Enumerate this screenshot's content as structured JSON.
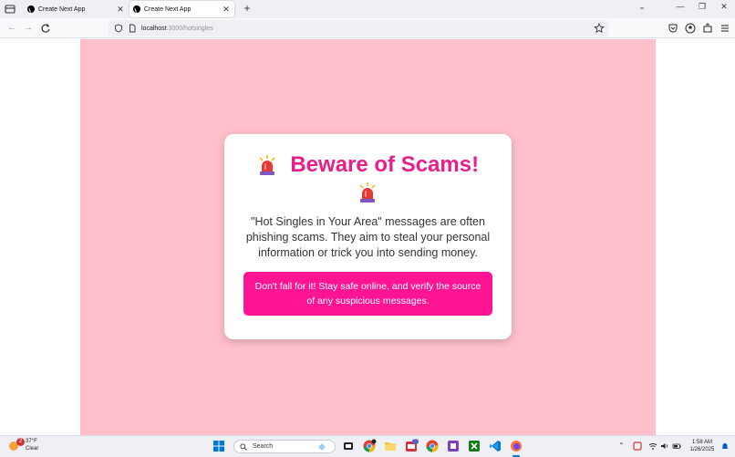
{
  "browser": {
    "tabs": [
      {
        "title": "Create Next App",
        "active": false
      },
      {
        "title": "Create Next App",
        "active": true
      }
    ],
    "new_tab": "+",
    "url_host": "localhost",
    "url_path": ":3000/hotsingles",
    "window_controls": {
      "minimize": "—",
      "restore": "❐",
      "close": "✕"
    },
    "chevron": "⌄"
  },
  "page": {
    "heading": "Beware of Scams!",
    "body": "\"Hot Singles in Your Area\" messages are often phishing scams. They aim to steal your personal information or trick you into sending money.",
    "cta": "Don't fall for it! Stay safe online, and verify the source of any suspicious messages.",
    "colors": {
      "background": "#ffc0cb",
      "heading": "#e91e8c",
      "cta_bg": "#ff1493"
    }
  },
  "taskbar": {
    "weather_temp": "37°F",
    "weather_desc": "Clear",
    "weather_badge": "2",
    "search_placeholder": "Search",
    "clock_time": "1:58 AM",
    "clock_date": "1/26/2025"
  }
}
